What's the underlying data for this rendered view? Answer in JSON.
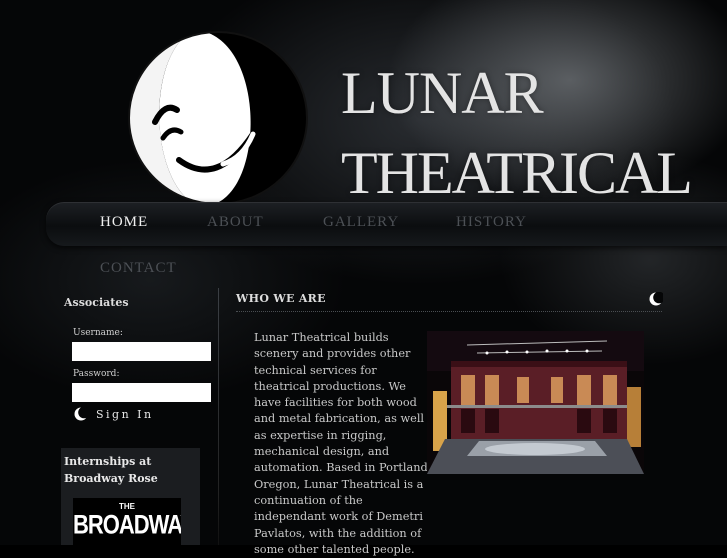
{
  "header": {
    "title_line1": "LUNAR",
    "title_line2": "THEATRICAL"
  },
  "nav": {
    "items": [
      {
        "label": "HOME",
        "active": true
      },
      {
        "label": "ABOUT",
        "active": false
      },
      {
        "label": "GALLERY",
        "active": false
      },
      {
        "label": "HISTORY",
        "active": false
      },
      {
        "label": "CONTACT",
        "active": false
      }
    ]
  },
  "sidebar": {
    "heading": "Associates",
    "username_label": "Username:",
    "username_value": "",
    "password_label": "Password:",
    "password_value": "",
    "signin_label": "Sign In",
    "signin_icon": "crescent-moon-icon",
    "internships_title": "Internships at Broadway Rose",
    "broadway_logo_small": "THE",
    "broadway_logo_big": "BROADWAY"
  },
  "main": {
    "heading": "WHO WE ARE",
    "heading_icon": "crescent-moon-icon",
    "body": "Lunar Theatrical builds scenery and provides other technical services for theatrical productions. We have facilities for both wood and metal fabrication, as well as expertise in rigging, mechanical design, and automation. Based in Portland, Oregon, Lunar Theatrical is a continuation of the independant work of Demetri Pavlatos, with the addition of some other talented people."
  },
  "colors": {
    "background": "#050607",
    "nav_active": "#f0f0f0",
    "nav_inactive": "#4c5055",
    "title": "#e4e4e4",
    "body_text": "#c9c9c9"
  }
}
